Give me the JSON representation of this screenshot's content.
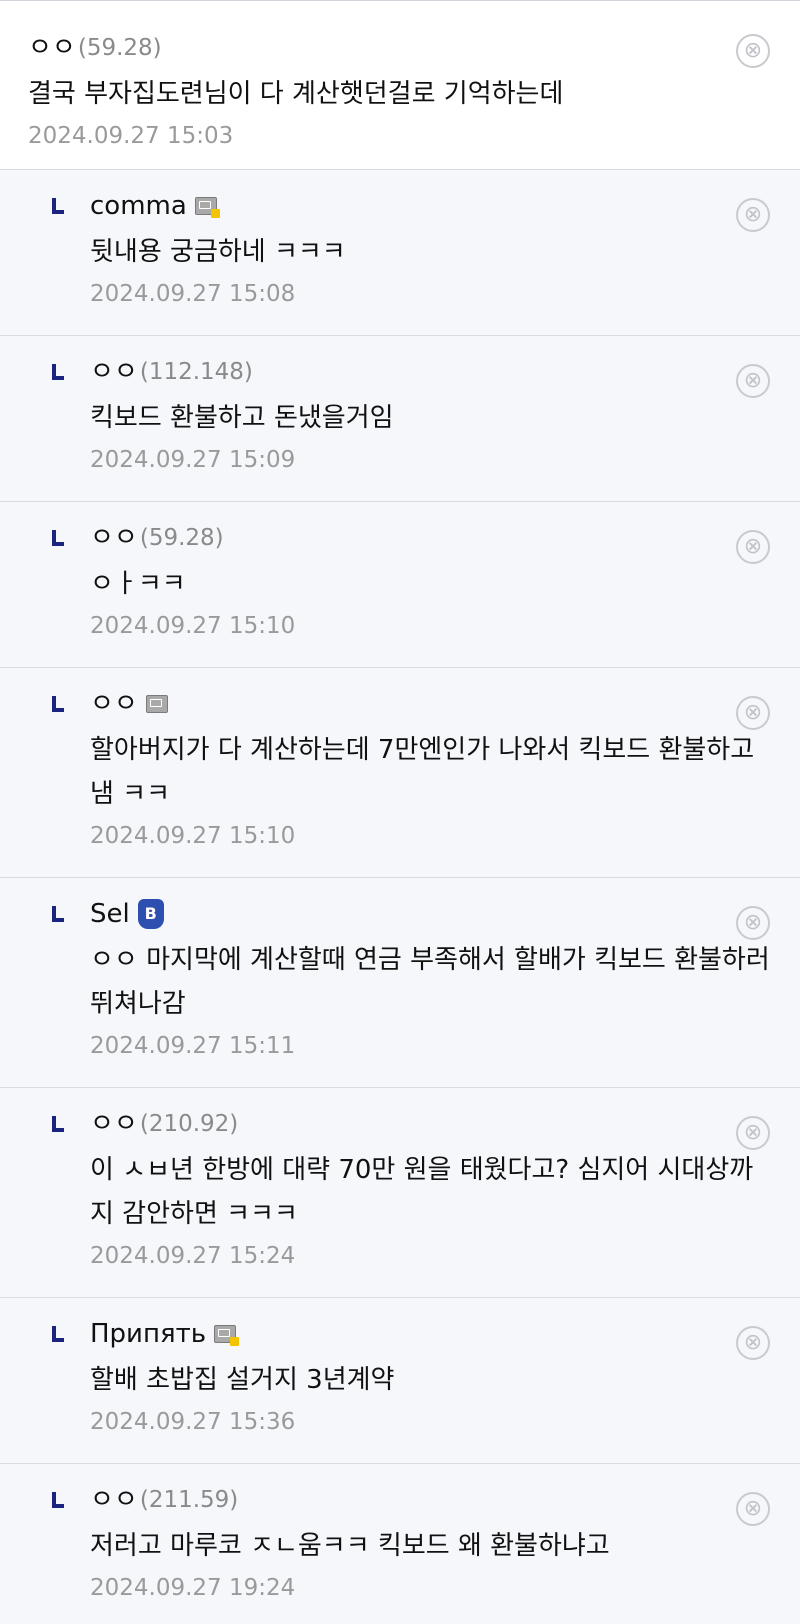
{
  "comments": [
    {
      "kind": "top",
      "nick": "ㅇㅇ",
      "ip": "(59.28)",
      "text": "결국 부자집도련님이 다 계산햇던걸로 기억하는데",
      "date": "2024.09.27 15:03",
      "delete_label": "⊗"
    },
    {
      "kind": "reply",
      "nick": "comma",
      "icon": "fixed-nick-icon",
      "text": "뒷내용 궁금하네 ㅋㅋㅋ",
      "date": "2024.09.27 15:08",
      "delete_label": "⊗"
    },
    {
      "kind": "reply",
      "nick": "ㅇㅇ",
      "ip": "(112.148)",
      "text": "킥보드 환불하고 돈냈을거임",
      "date": "2024.09.27 15:09",
      "delete_label": "⊗"
    },
    {
      "kind": "reply",
      "nick": "ㅇㅇ",
      "ip": "(59.28)",
      "text": "ㅇㅏㅋㅋ",
      "date": "2024.09.27 15:10",
      "delete_label": "⊗"
    },
    {
      "kind": "reply",
      "nick": "ㅇㅇ",
      "icon": "semi-fixed-nick-icon",
      "text": "할아버지가 다 계산하는데 7만엔인가 나와서 킥보드 환불하고 냄 ㅋㅋ",
      "date": "2024.09.27 15:10",
      "delete_label": "⊗"
    },
    {
      "kind": "reply",
      "nick": "Sel",
      "icon": "b-badge-icon",
      "badge_letter": "B",
      "text": "ㅇㅇ 마지막에 계산할때 연금 부족해서 할배가 킥보드 환불하러 뛰쳐나감",
      "date": "2024.09.27 15:11",
      "delete_label": "⊗"
    },
    {
      "kind": "reply",
      "nick": "ㅇㅇ",
      "ip": "(210.92)",
      "text": "이 ㅅㅂ년 한방에 대략 70만 원을 태웠다고? 심지어 시대상까지 감안하면 ㅋㅋㅋ",
      "date": "2024.09.27 15:24",
      "delete_label": "⊗"
    },
    {
      "kind": "reply",
      "nick": "Припять",
      "icon": "fixed-nick-icon",
      "text": "할배 초밥집 설거지 3년계약",
      "date": "2024.09.27 15:36",
      "delete_label": "⊗"
    },
    {
      "kind": "reply",
      "nick": "ㅇㅇ",
      "ip": "(211.59)",
      "text": "저러고 마루코 ㅈㄴ움ㅋㅋ 킥보드 왜 환불하냐고",
      "date": "2024.09.27 19:24",
      "delete_label": "⊗"
    }
  ]
}
